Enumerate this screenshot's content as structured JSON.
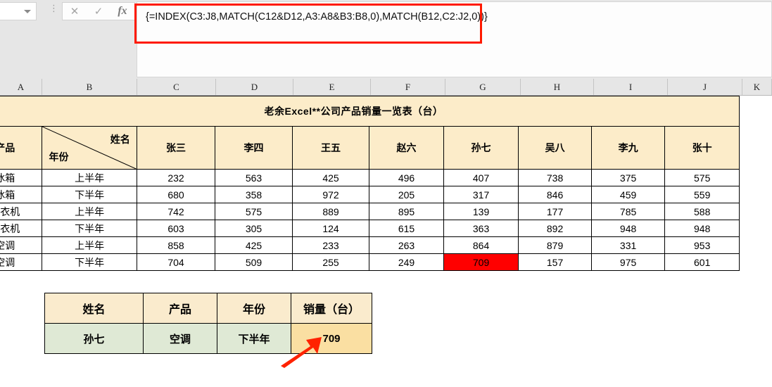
{
  "formula_bar": {
    "name_box_value": "",
    "cancel_icon": "close-icon",
    "confirm_icon": "check-icon",
    "function_icon": "fx-icon",
    "formula": "{=INDEX(C3:J8,MATCH(C12&D12,A3:A8&B3:B8,0),MATCH(B12,C2:J2,0))}",
    "highlight_color": "#ff1a00"
  },
  "column_headers": [
    "A",
    "B",
    "C",
    "D",
    "E",
    "F",
    "G",
    "H",
    "I",
    "J",
    "K"
  ],
  "main_table": {
    "title": "老余Excel**公司产品销量一览表（台）",
    "corner": {
      "upper_right_label": "姓名",
      "lower_left_label": "年份",
      "left_label": "产品"
    },
    "name_headers": [
      "张三",
      "李四",
      "王五",
      "赵六",
      "孙七",
      "吴八",
      "李九",
      "张十"
    ],
    "rows": [
      {
        "product": "冰箱",
        "period": "上半年",
        "values": [
          232,
          563,
          425,
          496,
          407,
          738,
          375,
          575
        ]
      },
      {
        "product": "冰箱",
        "period": "下半年",
        "values": [
          680,
          358,
          972,
          205,
          317,
          846,
          459,
          559
        ]
      },
      {
        "product": "洗衣机",
        "period": "上半年",
        "values": [
          742,
          575,
          889,
          895,
          139,
          177,
          785,
          588
        ]
      },
      {
        "product": "洗衣机",
        "period": "下半年",
        "values": [
          603,
          305,
          124,
          615,
          363,
          892,
          948,
          948
        ]
      },
      {
        "product": "空调",
        "period": "上半年",
        "values": [
          858,
          425,
          233,
          263,
          864,
          879,
          331,
          953
        ]
      },
      {
        "product": "空调",
        "period": "下半年",
        "values": [
          704,
          509,
          255,
          249,
          709,
          157,
          975,
          601
        ]
      }
    ],
    "highlighted_cell": {
      "row": 5,
      "col": 4,
      "value": 709,
      "fill": "#ff0000"
    },
    "header_fill": "#fcecc9"
  },
  "lookup_table": {
    "headers": [
      "姓名",
      "产品",
      "年份",
      "销量（台）"
    ],
    "values": [
      "孙七",
      "空调",
      "下半年",
      "709"
    ],
    "header_fill": "#faebcd",
    "value_fill": "#dfe9d5",
    "result_fill": "#fadfa2"
  },
  "annotation": {
    "arrow_color": "#ff2200",
    "arrow_target": "709"
  }
}
